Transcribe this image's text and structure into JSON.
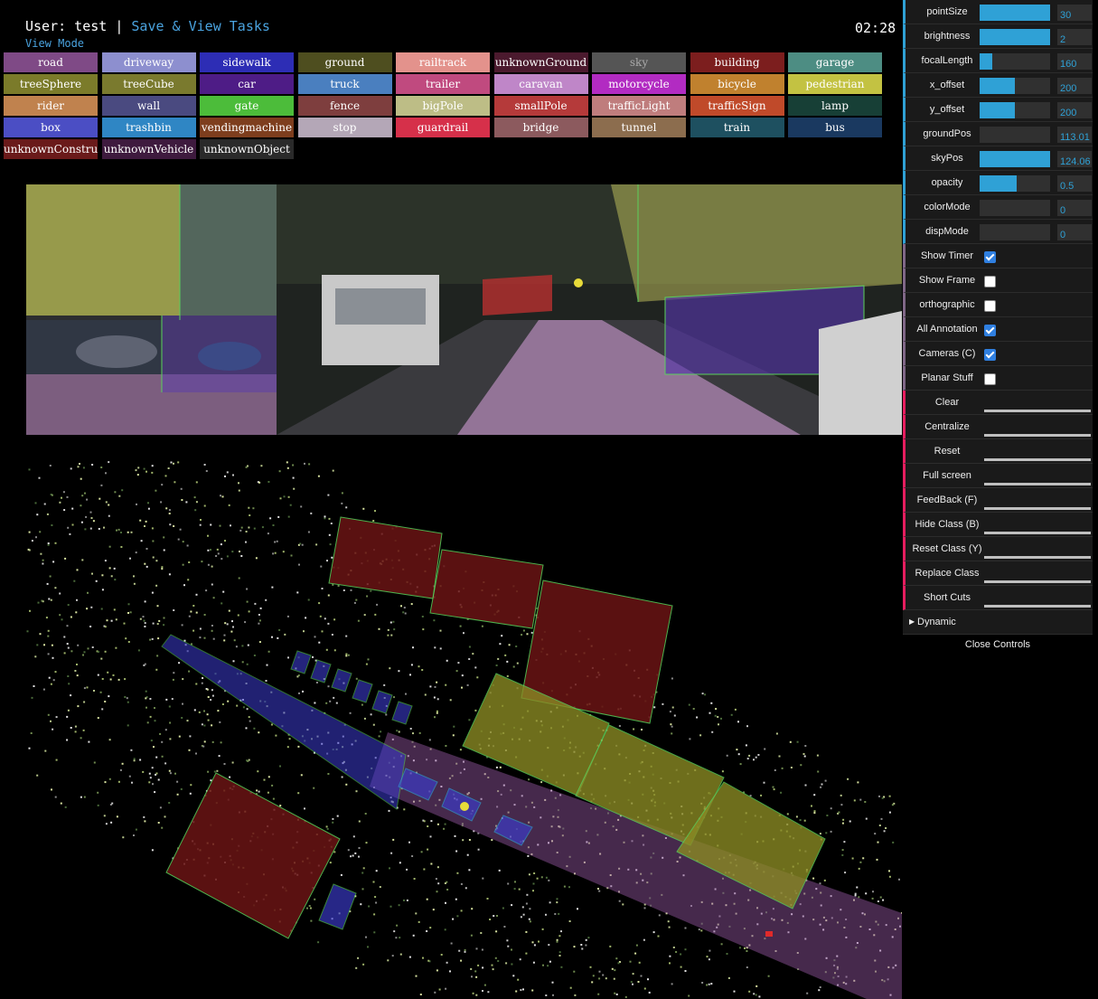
{
  "header": {
    "user_text": "User: test |",
    "save_link": "Save & View Tasks",
    "mode": "View Mode",
    "timer": "02:28"
  },
  "classes": [
    {
      "label": "road",
      "color": "#7f4a86"
    },
    {
      "label": "driveway",
      "color": "#8d8fcf"
    },
    {
      "label": "sidewalk",
      "color": "#2d2db5"
    },
    {
      "label": "ground",
      "color": "#4e4e1f"
    },
    {
      "label": "railtrack",
      "color": "#e3928c"
    },
    {
      "label": "unknownGround",
      "color": "#4b1a2e"
    },
    {
      "label": "sky",
      "color": "#555555"
    },
    {
      "label": "building",
      "color": "#7c1e1e"
    },
    {
      "label": "garage",
      "color": "#4d8d83"
    },
    {
      "label": "treeSphere",
      "color": "#7b7b2a"
    },
    {
      "label": "treeCube",
      "color": "#7a7a2e"
    },
    {
      "label": "car",
      "color": "#4e1c86"
    },
    {
      "label": "truck",
      "color": "#4a7fbf"
    },
    {
      "label": "trailer",
      "color": "#c04a7f"
    },
    {
      "label": "caravan",
      "color": "#bf86c8"
    },
    {
      "label": "motorcycle",
      "color": "#b22bc2"
    },
    {
      "label": "bicycle",
      "color": "#c0812e"
    },
    {
      "label": "pedestrian",
      "color": "#c3c242"
    },
    {
      "label": "rider",
      "color": "#c0824e"
    },
    {
      "label": "wall",
      "color": "#4a4a80"
    },
    {
      "label": "gate",
      "color": "#4cbc3a"
    },
    {
      "label": "fence",
      "color": "#7e3e3e"
    },
    {
      "label": "bigPole",
      "color": "#bdbd86"
    },
    {
      "label": "smallPole",
      "color": "#b53a3a"
    },
    {
      "label": "trafficLight",
      "color": "#bf7d7d"
    },
    {
      "label": "trafficSign",
      "color": "#c04a2a"
    },
    {
      "label": "lamp",
      "color": "#173f36"
    },
    {
      "label": "box",
      "color": "#4b4ec4"
    },
    {
      "label": "trashbin",
      "color": "#2f86c4"
    },
    {
      "label": "vendingmachine",
      "color": "#7e3e1e"
    },
    {
      "label": "stop",
      "color": "#b4a7b7"
    },
    {
      "label": "guardrail",
      "color": "#d6304a"
    },
    {
      "label": "bridge",
      "color": "#8c5a5e"
    },
    {
      "label": "tunnel",
      "color": "#8c6d4e"
    },
    {
      "label": "train",
      "color": "#1e5060"
    },
    {
      "label": "bus",
      "color": "#1a3960"
    },
    {
      "label": "unknownConstruction",
      "color": "#6a1a1a"
    },
    {
      "label": "unknownVehicle",
      "color": "#3e1a3e"
    },
    {
      "label": "unknownObject",
      "color": "#2a2a2a"
    }
  ],
  "controls": {
    "sliders": [
      {
        "label": "pointSize",
        "value": "30",
        "level": 1.0
      },
      {
        "label": "brightness",
        "value": "2",
        "level": 1.0
      },
      {
        "label": "focalLength",
        "value": "160",
        "level": 0.18
      },
      {
        "label": "x_offset",
        "value": "200",
        "level": 0.5
      },
      {
        "label": "y_offset",
        "value": "200",
        "level": 0.5
      },
      {
        "label": "groundPos",
        "value": "113.01",
        "level": 0.0
      },
      {
        "label": "skyPos",
        "value": "124.06",
        "level": 1.0
      },
      {
        "label": "opacity",
        "value": "0.5",
        "level": 0.52
      },
      {
        "label": "colorMode",
        "value": "0",
        "level": 0.0
      },
      {
        "label": "dispMode",
        "value": "0",
        "level": 0.0
      }
    ],
    "checkboxes": [
      {
        "label": "Show Timer",
        "checked": true
      },
      {
        "label": "Show Frame",
        "checked": false
      },
      {
        "label": "orthographic",
        "checked": false
      },
      {
        "label": "All Annotation",
        "checked": true
      },
      {
        "label": "Cameras (C)",
        "checked": true
      },
      {
        "label": "Planar Stuff",
        "checked": false
      }
    ],
    "buttons": [
      "Clear",
      "Centralize",
      "Reset",
      "Full screen",
      "FeedBack (F)",
      "Hide Class (B)",
      "Reset Class (Y)",
      "Replace Class",
      "Short Cuts"
    ],
    "folder": "Dynamic",
    "close": "Close Controls"
  }
}
